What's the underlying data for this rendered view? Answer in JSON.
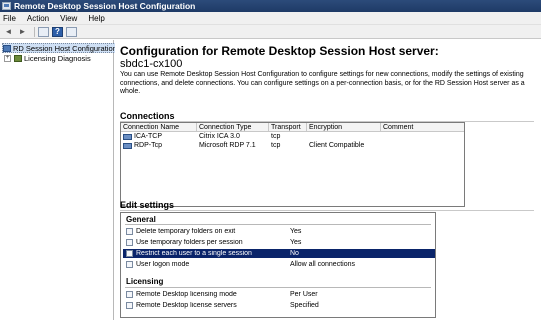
{
  "window": {
    "title": "Remote Desktop Session Host Configuration"
  },
  "menu": {
    "items": [
      "File",
      "Action",
      "View",
      "Help"
    ]
  },
  "toolbar": {
    "back": "◄",
    "forward": "►",
    "help": "?"
  },
  "tree": {
    "root_label": "RD Session Host Configuration:",
    "child_label": "Licensing Diagnosis"
  },
  "main": {
    "heading": "Configuration for Remote Desktop Session Host server:",
    "server": "sbdc1-cx100",
    "intro": "You can use Remote Desktop Session Host Configuration to configure settings for new connections, modify the settings of existing connections, and delete connections. You can configure settings on a per-connection basis, or for the RD Session Host server as a whole."
  },
  "connections": {
    "title": "Connections",
    "columns": [
      "Connection Name",
      "Connection Type",
      "Transport",
      "Encryption",
      "Comment"
    ],
    "rows": [
      {
        "name": "ICA-TCP",
        "type": "Citrix ICA 3.0",
        "transport": "tcp",
        "encryption": "",
        "comment": ""
      },
      {
        "name": "RDP-Tcp",
        "type": "Microsoft RDP 7.1",
        "transport": "tcp",
        "encryption": "Client Compatible",
        "comment": ""
      }
    ]
  },
  "edit": {
    "title": "Edit settings",
    "general_title": "General",
    "general": [
      {
        "name": "Delete temporary folders on exit",
        "value": "Yes"
      },
      {
        "name": "Use temporary folders per session",
        "value": "Yes"
      },
      {
        "name": "Restrict each user to a single session",
        "value": "No"
      },
      {
        "name": "User logon mode",
        "value": "Allow all connections"
      }
    ],
    "licensing_title": "Licensing",
    "licensing": [
      {
        "name": "Remote Desktop licensing mode",
        "value": "Per User"
      },
      {
        "name": "Remote Desktop license servers",
        "value": "Specified"
      }
    ]
  },
  "colors": {
    "titlebar": "#1e3a66",
    "selection": "#0a246a",
    "tree_selection": "#cfe0f5"
  }
}
